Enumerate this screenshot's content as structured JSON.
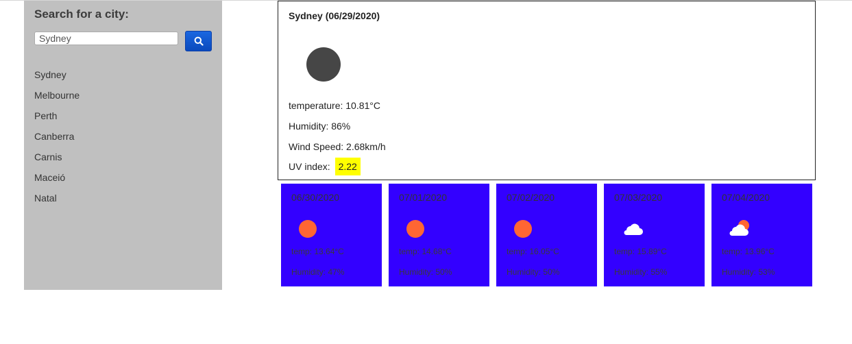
{
  "sidebar": {
    "heading": "Search for a city:",
    "search": {
      "value": "Sydney",
      "placeholder": ""
    },
    "search_button_icon": "search-icon",
    "cities": [
      "Sydney",
      "Melbourne",
      "Perth",
      "Canberra",
      "Carnis",
      "Maceió",
      "Natal"
    ]
  },
  "current": {
    "title": "Sydney (06/29/2020)",
    "icon": "dark-circle-icon",
    "temperature": "temperature: 10.81°C",
    "humidity": "Humidity: 86%",
    "wind": "Wind Speed: 2.68km/h",
    "uv_label": "UV index:",
    "uv_value": "2.22"
  },
  "forecast": [
    {
      "date": "06/30/2020",
      "icon": "sun-icon",
      "temp": "temp: 13.64°C",
      "humidity": "Humidity: 47%"
    },
    {
      "date": "07/01/2020",
      "icon": "sun-icon",
      "temp": "temp: 14.68°C",
      "humidity": "Humidity: 50%"
    },
    {
      "date": "07/02/2020",
      "icon": "sun-icon",
      "temp": "temp: 16.05°C",
      "humidity": "Humidity: 50%"
    },
    {
      "date": "07/03/2020",
      "icon": "cloud-icon",
      "temp": "temp: 15.89°C",
      "humidity": "Humidity: 55%"
    },
    {
      "date": "07/04/2020",
      "icon": "cloud-sun-icon",
      "temp": "temp: 13.96°C",
      "humidity": "Humidity: 53%"
    }
  ],
  "colors": {
    "sidebar_bg": "#c0c0c0",
    "search_button": "#0b57d0",
    "forecast_bg": "#3300ff",
    "uv_highlight": "#ffff00",
    "sun": "#ff6633"
  }
}
